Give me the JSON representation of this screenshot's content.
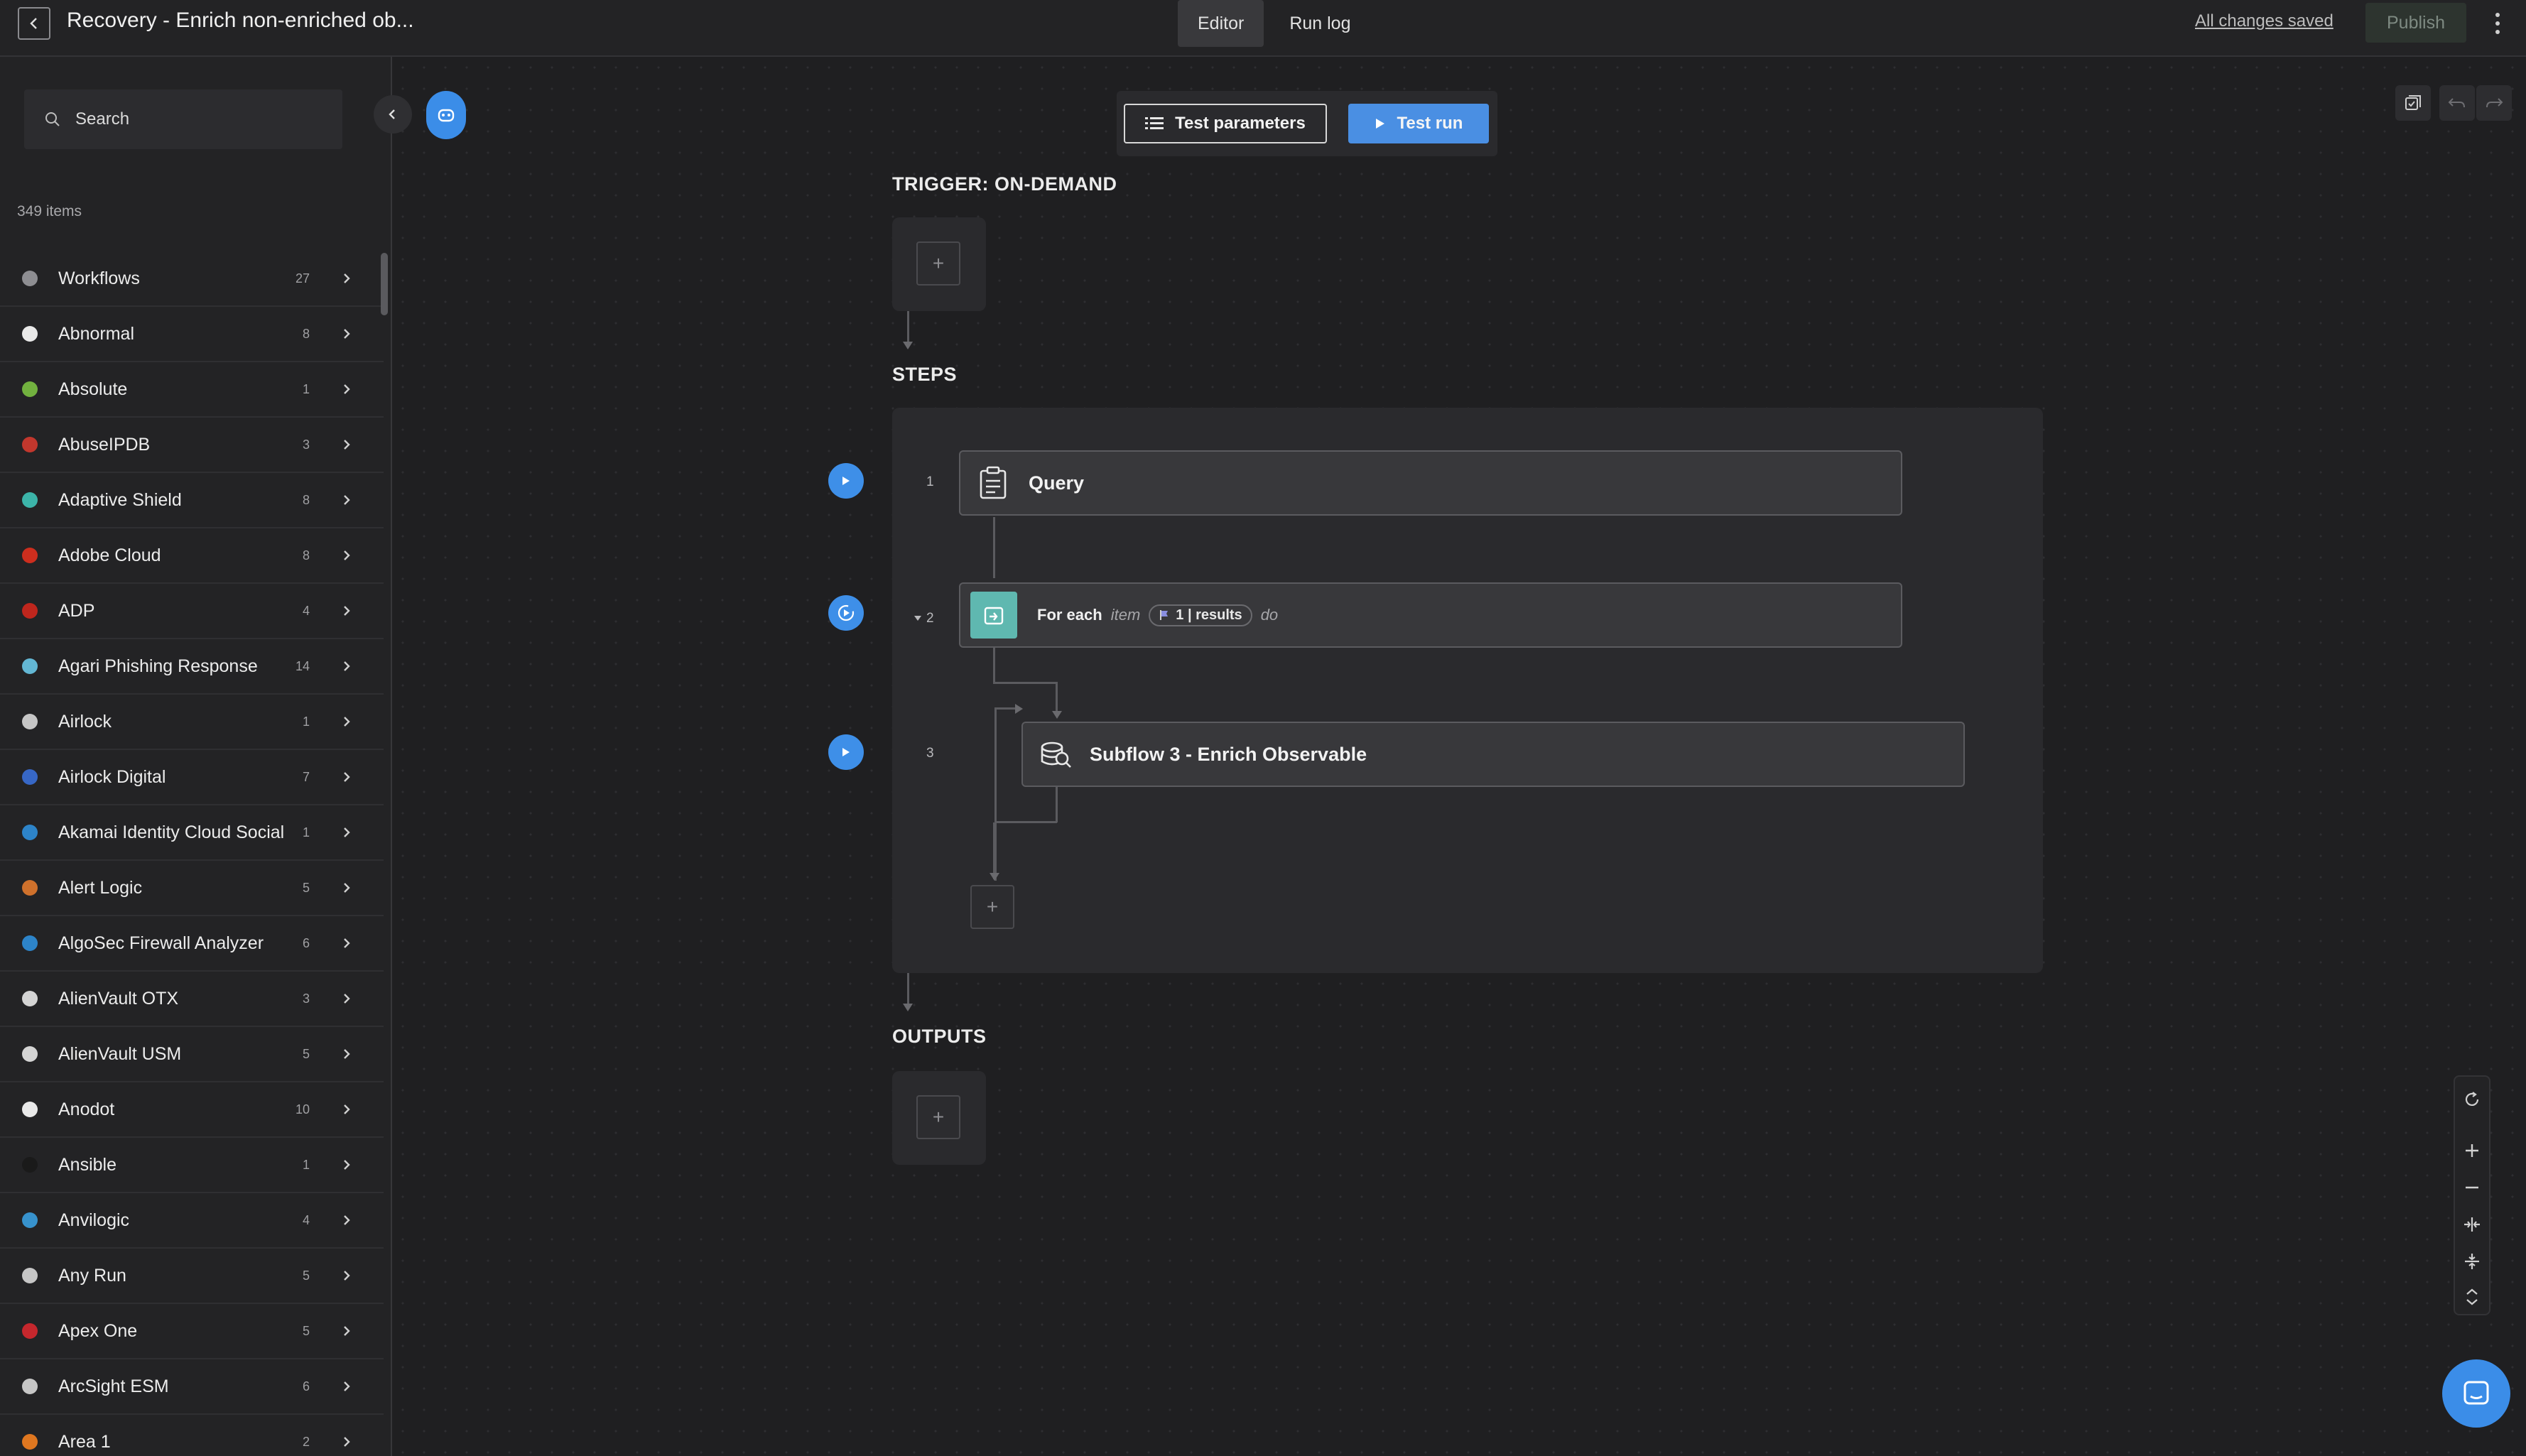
{
  "header": {
    "title": "Recovery - Enrich non-enriched ob...",
    "tabs": [
      {
        "label": "Editor",
        "active": true
      },
      {
        "label": "Run log",
        "active": false
      }
    ],
    "saved_status": "All changes saved",
    "publish_label": "Publish"
  },
  "sidebar": {
    "search_placeholder": "Search",
    "count_label": "349 items",
    "items": [
      {
        "label": "Workflows",
        "count": "27",
        "icon": "workflows-icon",
        "color": "#9a9a9e"
      },
      {
        "label": "Abnormal",
        "count": "8",
        "icon": "abnormal-icon",
        "color": "#ffffff"
      },
      {
        "label": "Absolute",
        "count": "1",
        "icon": "absolute-icon",
        "color": "#7bc142"
      },
      {
        "label": "AbuseIPDB",
        "count": "3",
        "icon": "abuseipdb-icon",
        "color": "#d43a2f"
      },
      {
        "label": "Adaptive Shield",
        "count": "8",
        "icon": "adaptive-shield-icon",
        "color": "#3fc4b8"
      },
      {
        "label": "Adobe Cloud",
        "count": "8",
        "icon": "adobe-cloud-icon",
        "color": "#e0301e"
      },
      {
        "label": "ADP",
        "count": "4",
        "icon": "adp-icon",
        "color": "#d0271d"
      },
      {
        "label": "Agari Phishing Response",
        "count": "14",
        "icon": "agari-icon",
        "color": "#6ac8e8"
      },
      {
        "label": "Airlock",
        "count": "1",
        "icon": "airlock-icon",
        "color": "#d8d8d8"
      },
      {
        "label": "Airlock Digital",
        "count": "7",
        "icon": "airlock-digital-icon",
        "color": "#3a6fd8"
      },
      {
        "label": "Akamai Identity Cloud Social",
        "count": "1",
        "icon": "akamai-icon",
        "color": "#2f8fdc"
      },
      {
        "label": "Alert Logic",
        "count": "5",
        "icon": "alert-logic-icon",
        "color": "#e27a2e"
      },
      {
        "label": "AlgoSec Firewall Analyzer",
        "count": "6",
        "icon": "algosec-icon",
        "color": "#2f8fdc"
      },
      {
        "label": "AlienVault OTX",
        "count": "3",
        "icon": "alienvault-otx-icon",
        "color": "#e8e8e8"
      },
      {
        "label": "AlienVault USM",
        "count": "5",
        "icon": "alienvault-usm-icon",
        "color": "#e8e8e8"
      },
      {
        "label": "Anodot",
        "count": "10",
        "icon": "anodot-icon",
        "color": "#ffffff"
      },
      {
        "label": "Ansible",
        "count": "1",
        "icon": "ansible-icon",
        "color": "#1a1a1a"
      },
      {
        "label": "Anvilogic",
        "count": "4",
        "icon": "anvilogic-icon",
        "color": "#3a9fe0"
      },
      {
        "label": "Any Run",
        "count": "5",
        "icon": "any-run-icon",
        "color": "#d8d8d8"
      },
      {
        "label": "Apex One",
        "count": "5",
        "icon": "apex-one-icon",
        "color": "#d7282f"
      },
      {
        "label": "ArcSight ESM",
        "count": "6",
        "icon": "arcsight-icon",
        "color": "#d8d8d8"
      },
      {
        "label": "Area 1",
        "count": "2",
        "icon": "area1-icon",
        "color": "#f48120"
      }
    ]
  },
  "toolbar": {
    "test_parameters_label": "Test parameters",
    "test_run_label": "Test run"
  },
  "flow": {
    "trigger_heading": "TRIGGER: ON-DEMAND",
    "steps_heading": "STEPS",
    "outputs_heading": "OUTPUTS",
    "steps": [
      {
        "number": "1",
        "title": "Query",
        "icon": "query-icon"
      },
      {
        "number": "2",
        "for_each": "For each",
        "item": "item",
        "pill_label": "1 | results",
        "do": "do",
        "icon": "loop-icon"
      },
      {
        "number": "3",
        "title": "Subflow 3 - Enrich Observable",
        "icon": "subflow-icon"
      }
    ],
    "add_symbol": "+"
  },
  "colors": {
    "accent": "#3e8fe8",
    "loop": "#5fb8b0"
  }
}
